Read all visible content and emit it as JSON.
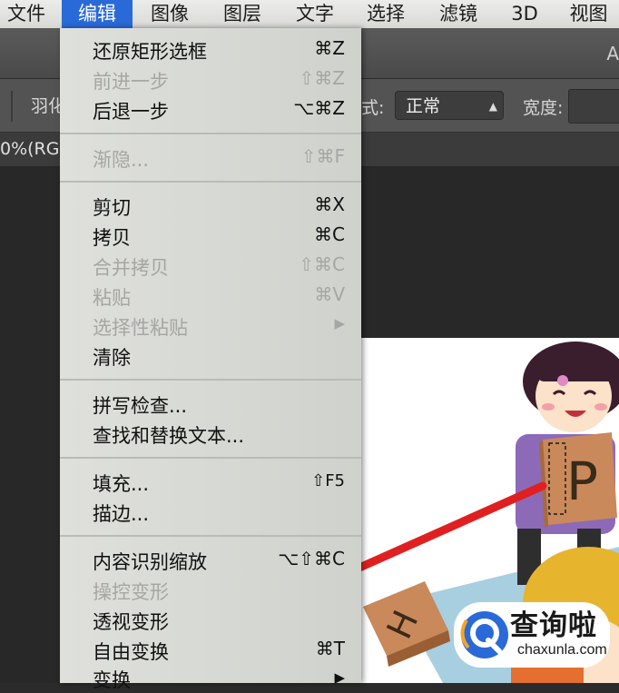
{
  "menubar": {
    "items": [
      "文件",
      "编辑",
      "图像",
      "图层",
      "文字",
      "选择",
      "滤镜",
      "3D",
      "视图"
    ]
  },
  "titlebar": {
    "title_fragment": "A"
  },
  "options": {
    "feather_label": "羽化",
    "style_label": "式:",
    "style_value": "正常",
    "width_label": "宽度:"
  },
  "doc_tab": {
    "label": "0%(RG"
  },
  "edit_menu": {
    "items": [
      {
        "label": "还原矩形选框",
        "shortcut": "⌘Z",
        "enabled": true
      },
      {
        "label": "前进一步",
        "shortcut": "⇧⌘Z",
        "enabled": false
      },
      {
        "label": "后退一步",
        "shortcut": "⌥⌘Z",
        "enabled": true
      },
      {
        "label": "渐隐...",
        "shortcut": "⇧⌘F",
        "enabled": false
      },
      {
        "label": "剪切",
        "shortcut": "⌘X",
        "enabled": true
      },
      {
        "label": "拷贝",
        "shortcut": "⌘C",
        "enabled": true
      },
      {
        "label": "合并拷贝",
        "shortcut": "⇧⌘C",
        "enabled": false
      },
      {
        "label": "粘贴",
        "shortcut": "⌘V",
        "enabled": false
      },
      {
        "label": "选择性粘贴",
        "shortcut": "▶",
        "enabled": false
      },
      {
        "label": "清除",
        "shortcut": "",
        "enabled": true
      },
      {
        "label": "拼写检查...",
        "shortcut": "",
        "enabled": true
      },
      {
        "label": "查找和替换文本...",
        "shortcut": "",
        "enabled": true
      },
      {
        "label": "填充...",
        "shortcut": "⇧F5",
        "enabled": true
      },
      {
        "label": "描边...",
        "shortcut": "",
        "enabled": true
      },
      {
        "label": "内容识别缩放",
        "shortcut": "⌥⇧⌘C",
        "enabled": true
      },
      {
        "label": "操控变形",
        "shortcut": "",
        "enabled": false
      },
      {
        "label": "透视变形",
        "shortcut": "",
        "enabled": true
      },
      {
        "label": "自由变换",
        "shortcut": "⌘T",
        "enabled": true
      },
      {
        "label": "变换",
        "shortcut": "▶",
        "enabled": true
      }
    ]
  },
  "canvas": {
    "tile_letter_p": "P",
    "tile_letter_h": "H"
  },
  "watermark": {
    "text": "查询啦",
    "sub": "chaxunla.com"
  },
  "colors": {
    "menubar_active": "#2a6ad8",
    "arrow": "#e02020"
  }
}
